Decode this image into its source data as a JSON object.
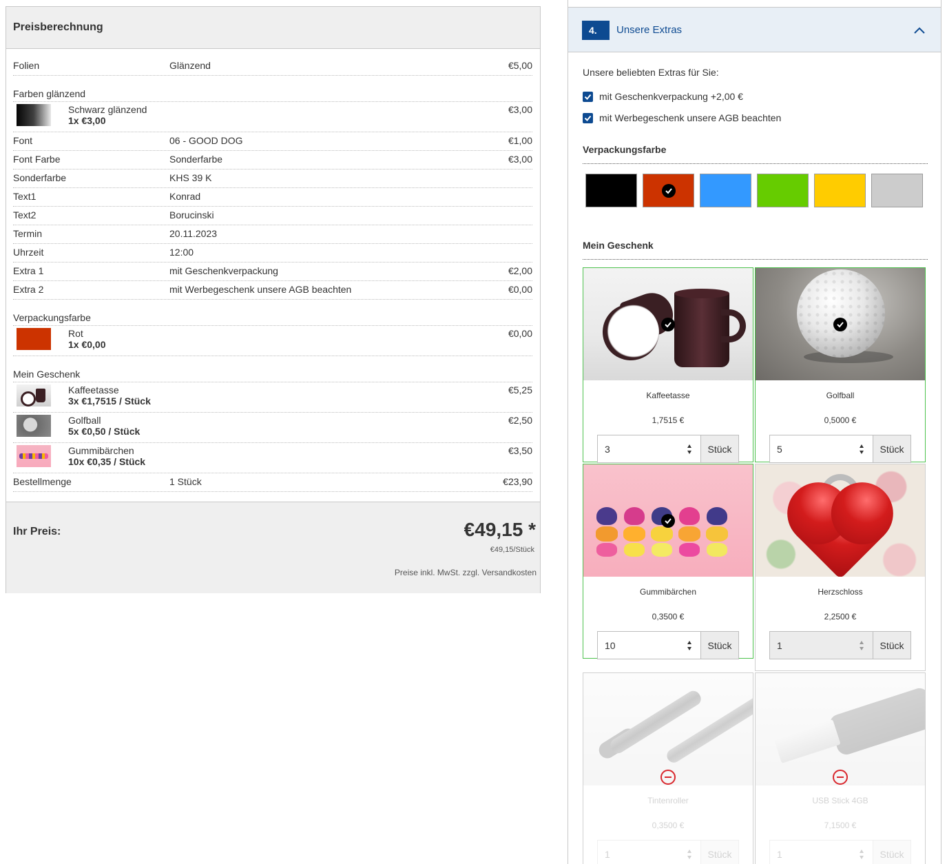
{
  "price": {
    "title": "Preisberechnung",
    "rows": {
      "folien": {
        "label": "Folien",
        "value": "Glänzend",
        "price": "€5,00"
      },
      "farben_section": "Farben glänzend",
      "farben_item": {
        "name": "Schwarz glänzend",
        "qty": "1x €3,00",
        "price": "€3,00"
      },
      "font": {
        "label": "Font",
        "value": "06 - GOOD DOG",
        "price": "€1,00"
      },
      "font_farbe": {
        "label": "Font Farbe",
        "value": "Sonderfarbe",
        "price": "€3,00"
      },
      "sonderfarbe": {
        "label": "Sonderfarbe",
        "value": "KHS 39 K"
      },
      "text1": {
        "label": "Text1",
        "value": "Konrad"
      },
      "text2": {
        "label": "Text2",
        "value": "Borucinski"
      },
      "termin": {
        "label": "Termin",
        "value": "20.11.2023"
      },
      "uhrzeit": {
        "label": "Uhrzeit",
        "value": "12:00"
      },
      "extra1": {
        "label": "Extra 1",
        "value": "mit Geschenkverpackung",
        "price": "€2,00"
      },
      "extra2": {
        "label": "Extra 2",
        "value": "mit Werbegeschenk unsere AGB beachten",
        "price": "€0,00"
      },
      "verpackung_section": "Verpackungsfarbe",
      "verpackung_item": {
        "name": "Rot",
        "qty": "1x €0,00",
        "price": "€0,00"
      },
      "geschenk_section": "Mein Geschenk",
      "gift_kaffee": {
        "name": "Kaffeetasse",
        "qty": "3x €1,7515 / Stück",
        "price": "€5,25"
      },
      "gift_golf": {
        "name": "Golfball",
        "qty": "5x €0,50 / Stück",
        "price": "€2,50"
      },
      "gift_gummi": {
        "name": "Gummibärchen",
        "qty": "10x €0,35 / Stück",
        "price": "€3,50"
      },
      "bestellmenge": {
        "label": "Bestellmenge",
        "value": "1 Stück",
        "price": "€23,90"
      }
    },
    "footer": {
      "label": "Ihr Preis:",
      "total": "€49,15 *",
      "unit_price": "€49,15/Stück",
      "note": "Preise inkl. MwSt. zzgl. Versandkosten"
    }
  },
  "extras": {
    "step": "4.",
    "title": "Unsere Extras",
    "chevron_icon": "chevron-up-icon",
    "intro": "Unsere beliebten Extras für Sie:",
    "options": [
      {
        "label": "mit Geschenkverpackung +2,00 €",
        "checked": true
      },
      {
        "label": "mit Werbegeschenk unsere AGB beachten",
        "checked": true
      }
    ],
    "packaging_title": "Verpackungsfarbe",
    "colors": [
      "#000000",
      "#cc3300",
      "#3399ff",
      "#66cc00",
      "#ffcc00",
      "#cccccc"
    ],
    "selected_color": "#cc3300",
    "gift_title": "Mein Geschenk",
    "gifts": [
      {
        "name": "Kaffeetasse",
        "price": "1,7515 €",
        "qty": "3",
        "unit": "Stück",
        "selected": true
      },
      {
        "name": "Golfball",
        "price": "0,5000 €",
        "qty": "5",
        "unit": "Stück",
        "selected": true
      },
      {
        "name": "Gummibärchen",
        "price": "0,3500 €",
        "qty": "10",
        "unit": "Stück",
        "selected": true
      },
      {
        "name": "Herzschloss",
        "price": "2,2500 €",
        "qty": "1",
        "unit": "Stück",
        "selected": false
      },
      {
        "name": "Tintenroller",
        "price": "0,3500 €",
        "qty": "1",
        "unit": "Stück",
        "disabled": true
      },
      {
        "name": "USB Stick 4GB",
        "price": "7,1500 €",
        "qty": "1",
        "unit": "Stück",
        "disabled": true
      }
    ],
    "accent_color": "#0d4a91",
    "selected_border_color": "#4cc24c",
    "blocked_icon": "minus-circle-icon",
    "check_icon": "check-circle-icon"
  }
}
